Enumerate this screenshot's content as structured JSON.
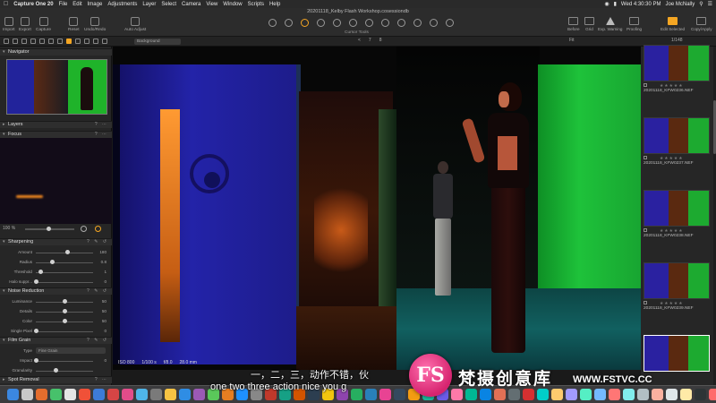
{
  "menubar": {
    "app_name": "Capture One 20",
    "items": [
      "File",
      "Edit",
      "Image",
      "Adjustments",
      "Layer",
      "Select",
      "Camera",
      "View",
      "Window",
      "Scripts",
      "Help"
    ],
    "clock": "Wed 4:30:30 PM",
    "user": "Joe McNally"
  },
  "window": {
    "title": "20201118_Kelby Flash Workshop.cosessiondb"
  },
  "toolbar": {
    "left_buttons": [
      "Import",
      "Export",
      "Capture",
      "Reset",
      "Undo/Redo",
      "Auto Adjust"
    ],
    "cursor_tools_label": "Cursor Tools",
    "right_buttons": [
      "Before",
      "Grid",
      "Exp. Warning",
      "Proofing",
      "Edit Selected",
      "Copy/Apply"
    ]
  },
  "strip": {
    "background_select": "Background",
    "pager": [
      "<",
      "7",
      "8"
    ],
    "fit": "Fit",
    "count": "1/148"
  },
  "panels": {
    "navigator": "Navigator",
    "layers": "Layers",
    "focus": "Focus",
    "zoom": "100 %",
    "sharpening": {
      "title": "Sharpening",
      "rows": [
        {
          "label": "Amount",
          "value": "180",
          "pos": 0.55
        },
        {
          "label": "Radius",
          "value": "0.8",
          "pos": 0.28
        },
        {
          "label": "Threshold",
          "value": "1",
          "pos": 0.08
        },
        {
          "label": "Halo suppr...",
          "value": "0",
          "pos": 0.0
        }
      ]
    },
    "noise_reduction": {
      "title": "Noise Reduction",
      "rows": [
        {
          "label": "Luminance",
          "value": "50",
          "pos": 0.5
        },
        {
          "label": "Details",
          "value": "50",
          "pos": 0.5
        },
        {
          "label": "Color",
          "value": "50",
          "pos": 0.5
        },
        {
          "label": "Single Pixel",
          "value": "0",
          "pos": 0.0
        }
      ]
    },
    "film_grain": {
      "title": "Film Grain",
      "type_label": "Type",
      "type_value": "Fine Grain",
      "rows": [
        {
          "label": "Impact",
          "value": "0",
          "pos": 0.0
        },
        {
          "label": "Granularity",
          "value": "",
          "pos": 0.35
        }
      ]
    },
    "spot_removal": "Spot Removal"
  },
  "exif": [
    "ISO 800",
    "1/100 s",
    "f/8.0",
    "28.0 mm"
  ],
  "filmstrip": [
    {
      "name": "20201118_KFW0236.NEF",
      "selected": false
    },
    {
      "name": "20201118_KFW0237.NEF",
      "selected": false
    },
    {
      "name": "20201118_KFW0238.NEF",
      "selected": false
    },
    {
      "name": "20201118_KFW0239.NEF",
      "selected": false
    },
    {
      "name": "",
      "selected": true
    }
  ],
  "subtitles": {
    "chinese": "一，二，三，动作不错，伙",
    "english": "one two three action nice you g"
  },
  "watermark": {
    "logo": "FS",
    "name_cn": "梵摄创意库",
    "url": "WWW.FSTVC.CC"
  }
}
